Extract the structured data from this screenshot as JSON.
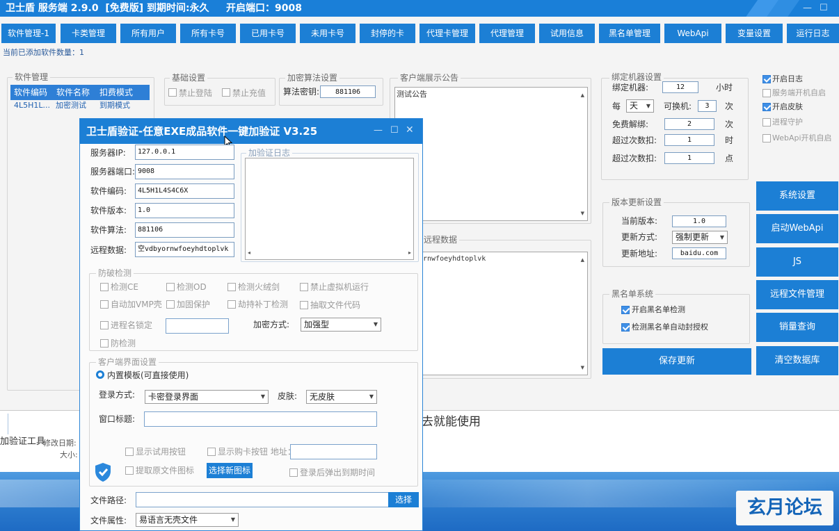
{
  "app": {
    "title": "卫士盾 服务端 2.9.0  [免费版] 到期时间:永久     开启端口：9008",
    "win_min": "—",
    "win_max": "☐"
  },
  "nav": [
    "软件管理-1",
    "卡类管理",
    "所有用户",
    "所有卡号",
    "已用卡号",
    "未用卡号",
    "封停的卡",
    "代理卡管理",
    "代理管理",
    "试用信息",
    "黑名单管理",
    "WebApi",
    "变量设置",
    "运行日志"
  ],
  "status": {
    "label": "当前已添加软件数量：",
    "count": "1"
  },
  "software": {
    "title": "软件管理",
    "headers": [
      "软件编码",
      "软件名称",
      "扣费模式"
    ],
    "row": [
      "4L5H1L...",
      "加密测试",
      "到期模式"
    ]
  },
  "basic": {
    "title": "基础设置",
    "ban_login": "禁止登陆",
    "ban_recharge": "禁止充值"
  },
  "encrypt": {
    "title": "加密算法设置",
    "key_label": "算法密钥:",
    "key_value": "881106"
  },
  "notice": {
    "title": "客户端展示公告",
    "text": "测试公告"
  },
  "remote": {
    "title": "远程数据",
    "text": "rnwfoeyhdtoplvk"
  },
  "bind": {
    "title": "绑定机器设置",
    "machine_label": "绑定机器:",
    "machine_value": "12",
    "machine_unit": "小时",
    "per_label": "每",
    "per_value": "天",
    "change_label": "可换机:",
    "change_value": "3",
    "change_unit": "次",
    "free_label": "免费解绑:",
    "free_value": "2",
    "free_unit": "次",
    "over1_label": "超过次数扣:",
    "over1_value": "1",
    "over1_unit": "时",
    "over2_label": "超过次数扣:",
    "over2_value": "1",
    "over2_unit": "点"
  },
  "options": {
    "log": "开启日志",
    "autostart": "服务端开机自启",
    "skin": "开启皮肤",
    "guard": "进程守护",
    "webapi": "WebApi开机自启"
  },
  "version": {
    "title": "版本更新设置",
    "current_label": "当前版本:",
    "current_value": "1.0",
    "method_label": "更新方式:",
    "method_value": "强制更新",
    "url_label": "更新地址:",
    "url_value": "baidu.com"
  },
  "blacklist": {
    "title": "黑名单系统",
    "enable": "开启黑名单检测",
    "auto_ban": "检测黑名单自动封授权"
  },
  "side_buttons": [
    "系统设置",
    "启动WebApi",
    "JS",
    "远程文件管理",
    "销量查询",
    "清空数据库"
  ],
  "save_button": "保存更新",
  "background": {
    "explorer_name": "加验证工具",
    "modified": "修改日期:",
    "size": "大小:",
    "doc_text": "去就能使用"
  },
  "dialog": {
    "title": "卫士盾验证-任意EXE成品软件一键加验证 V3.25",
    "ip_label": "服务器IP:",
    "ip_value": "127.0.0.1",
    "port_label": "服务器端口:",
    "port_value": "9008",
    "code_label": "软件编码:",
    "code_value": "4L5H1L4S4C6X",
    "version_label": "软件版本:",
    "version_value": "1.0",
    "algo_label": "软件算法:",
    "algo_value": "881106",
    "remote_label": "远程数据:",
    "remote_value": "空vdbyornwfoeyhdtoplvk",
    "log_title": "加验证日志",
    "protect": {
      "title": "防破检测",
      "ce": "检测CE",
      "od": "检测OD",
      "hxj": "检测火绒剑",
      "novm": "禁止虚拟机运行",
      "vmp": "自动加VMP壳",
      "reinforce": "加固保护",
      "patch": "劫持补丁检测",
      "extract": "抽取文件代码",
      "proc_lock": "进程名锁定",
      "anti": "防检测",
      "enc_label": "加密方式:",
      "enc_value": "加强型"
    },
    "ui": {
      "title": "客户端界面设置",
      "builtin": "内置模板(可直接使用)",
      "login_label": "登录方式:",
      "login_value": "卡密登录界面",
      "skin_label": "皮肤:",
      "skin_value": "无皮肤",
      "wintitle_label": "窗口标题:",
      "show_trial": "显示试用按钮",
      "show_buy": "显示购卡按钮 地址：",
      "extract_icon": "提取原文件图标",
      "choose_icon": "选择新图标",
      "expire_popup": "登录后弹出到期时间"
    },
    "filepath_label": "文件路径:",
    "select_button": "选择",
    "fileattr_label": "文件属性:",
    "fileattr_value": "易语言无壳文件"
  },
  "watermark": "玄月论坛"
}
